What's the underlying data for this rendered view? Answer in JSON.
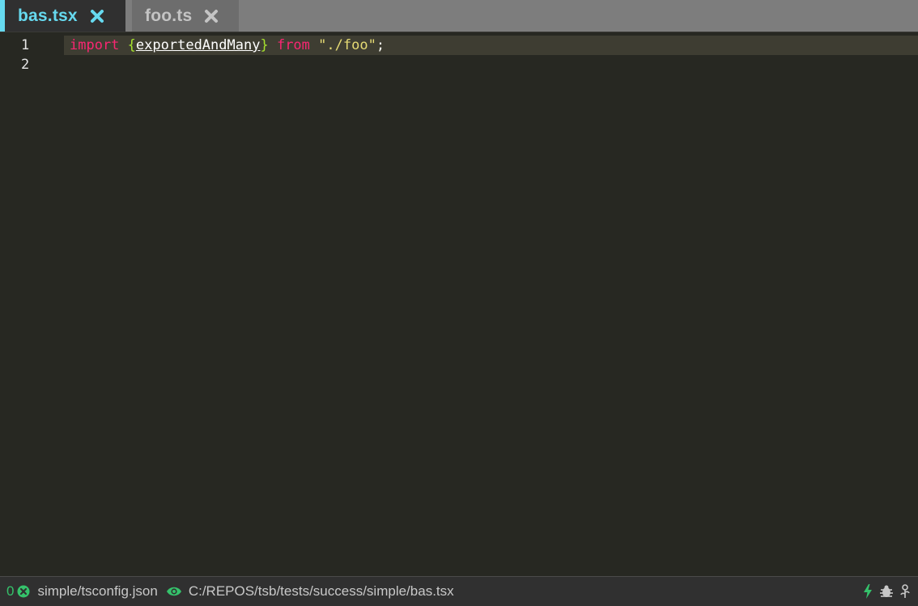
{
  "tabs": [
    {
      "label": "bas.tsx",
      "active": true
    },
    {
      "label": "foo.ts",
      "active": false
    }
  ],
  "editor": {
    "lines": [
      {
        "number": "1"
      },
      {
        "number": "2"
      }
    ],
    "code_line_1": {
      "keyword_import": "import",
      "brace_open": "{",
      "identifier": "exportedAndMany",
      "brace_close": "}",
      "keyword_from": "from",
      "string": "\"./foo\"",
      "semicolon": ";"
    }
  },
  "statusbar": {
    "error_count": "0",
    "tsconfig": "simple/tsconfig.json",
    "file_path": "C:/REPOS/tsb/tests/success/simple/bas.tsx",
    "icons": [
      "errors-icon",
      "eye-icon",
      "lightning-icon",
      "bug-icon",
      "flower-icon"
    ]
  },
  "colors": {
    "background": "#272822",
    "active_tab_accent": "#66d9ef",
    "keyword": "#f92672",
    "brace": "#a6e22e",
    "string": "#e6db74",
    "status_green": "#35c26b"
  }
}
